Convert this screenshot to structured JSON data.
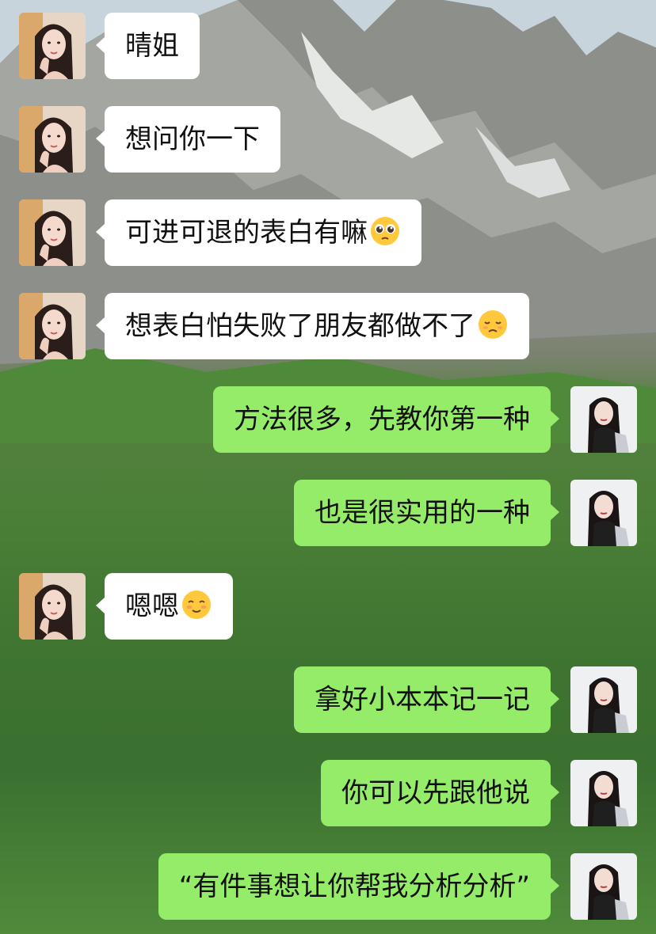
{
  "contacts": {
    "other_avatar_icon": "female-portrait-icon",
    "self_avatar_icon": "female-portrait-dark-hair-icon"
  },
  "colors": {
    "sent_bubble": "#95ec69",
    "received_bubble": "#ffffff",
    "text": "#111111"
  },
  "messages": [
    {
      "side": "left",
      "text": "晴姐",
      "emoji": ""
    },
    {
      "side": "left",
      "text": "想问你一下",
      "emoji": ""
    },
    {
      "side": "left",
      "text": "可进可退的表白有嘛",
      "emoji": "pleading-face-emoji"
    },
    {
      "side": "left",
      "text": "想表白怕失败了朋友都做不了",
      "emoji": "disappointed-face-emoji"
    },
    {
      "side": "right",
      "text": "方法很多，先教你第一种",
      "emoji": ""
    },
    {
      "side": "right",
      "text": "也是很实用的一种",
      "emoji": ""
    },
    {
      "side": "left",
      "text": "嗯嗯",
      "emoji": "smiling-face-emoji"
    },
    {
      "side": "right",
      "text": "拿好小本本记一记",
      "emoji": ""
    },
    {
      "side": "right",
      "text": "你可以先跟他说",
      "emoji": ""
    },
    {
      "side": "right",
      "text": "“有件事想让你帮我分析分析”",
      "emoji": ""
    }
  ]
}
